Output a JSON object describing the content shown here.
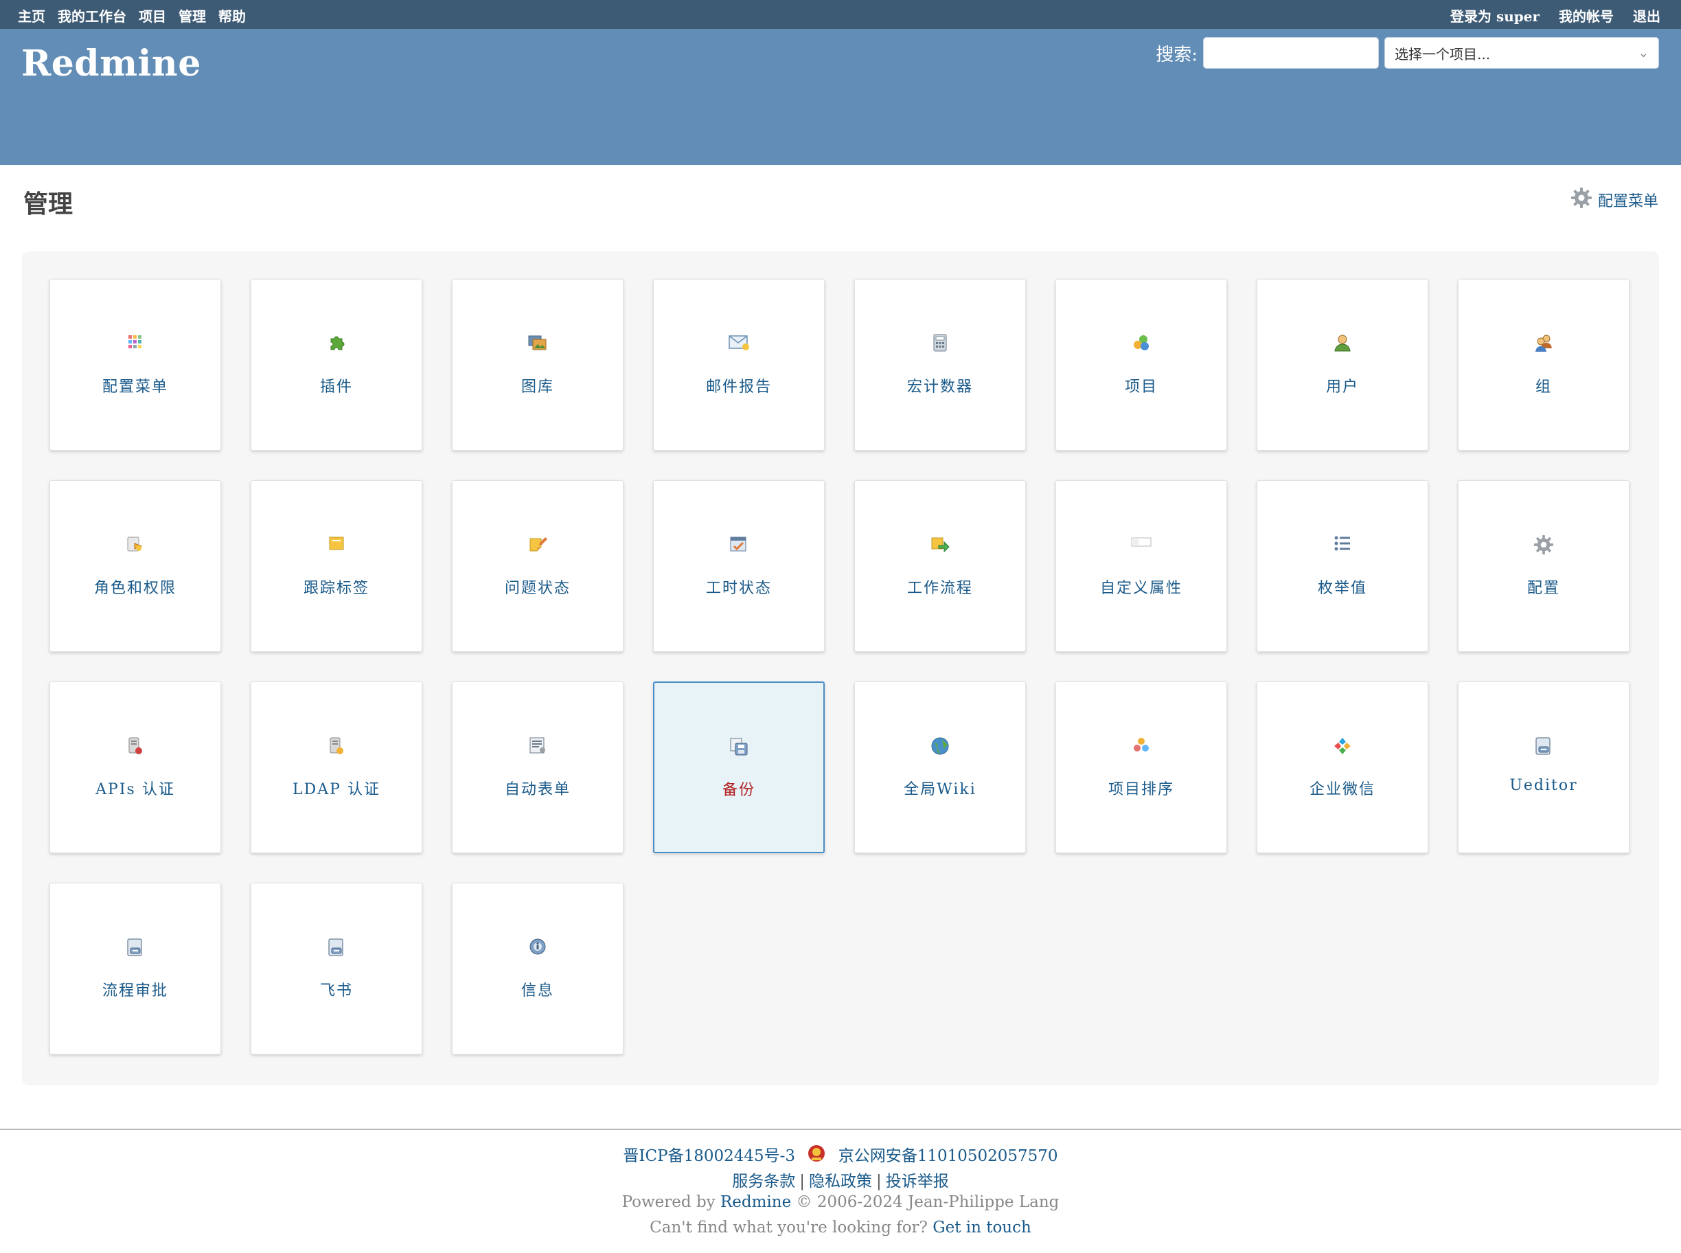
{
  "top_menu": {
    "home": "主页",
    "my_page": "我的工作台",
    "projects": "项目",
    "admin": "管理",
    "help": "帮助",
    "logged_as_prefix": "登录为",
    "logged_as_user": "super",
    "my_account": "我的帐号",
    "logout": "退出"
  },
  "header": {
    "title": "Redmine",
    "search_label": "搜索:",
    "search_value": "",
    "project_jump": "选择一个项目..."
  },
  "page": {
    "title": "管理",
    "config_menu_link": "配置菜单"
  },
  "admin_items": [
    {
      "label": "配置菜单",
      "icon": "grid-icon"
    },
    {
      "label": "插件",
      "icon": "plugin-icon"
    },
    {
      "label": "图库",
      "icon": "gallery-icon"
    },
    {
      "label": "邮件报告",
      "icon": "email-icon"
    },
    {
      "label": "宏计数器",
      "icon": "calculator-icon"
    },
    {
      "label": "项目",
      "icon": "projects-icon"
    },
    {
      "label": "用户",
      "icon": "user-icon"
    },
    {
      "label": "组",
      "icon": "group-icon"
    },
    {
      "label": "角色和权限",
      "icon": "role-icon"
    },
    {
      "label": "跟踪标签",
      "icon": "tracker-icon"
    },
    {
      "label": "问题状态",
      "icon": "issue-status-icon"
    },
    {
      "label": "工时状态",
      "icon": "time-status-icon"
    },
    {
      "label": "工作流程",
      "icon": "workflow-icon"
    },
    {
      "label": "自定义属性",
      "icon": "custom-field-icon"
    },
    {
      "label": "枚举值",
      "icon": "list-icon"
    },
    {
      "label": "配置",
      "icon": "settings-gear-icon"
    },
    {
      "label": "APIs 认证",
      "icon": "api-auth-icon"
    },
    {
      "label": "LDAP 认证",
      "icon": "ldap-icon"
    },
    {
      "label": "自动表单",
      "icon": "auto-form-icon"
    },
    {
      "label": "备份",
      "icon": "backup-icon",
      "selected": true
    },
    {
      "label": "全局Wiki",
      "icon": "globe-icon"
    },
    {
      "label": "项目排序",
      "icon": "sort-icon"
    },
    {
      "label": "企业微信",
      "icon": "wecom-icon"
    },
    {
      "label": "Ueditor",
      "icon": "editor-icon"
    },
    {
      "label": "流程审批",
      "icon": "approval-icon"
    },
    {
      "label": "飞书",
      "icon": "feishu-icon"
    },
    {
      "label": "信息",
      "icon": "info-icon"
    }
  ],
  "footer": {
    "icp": "晋ICP备18002445号-3",
    "police": "京公网安备11010502057570",
    "terms": "服务条款",
    "privacy": "隐私政策",
    "complaint": "投诉举报",
    "powered_by": "Powered by",
    "redmine_link": "Redmine",
    "copyright": "© 2006-2024 Jean-Philippe Lang",
    "cant_find": "Can't find what you're looking for?",
    "get_in_touch": "Get in touch"
  },
  "colors": {
    "top_menu_bg": "#3e5b76",
    "header_bg": "#628db6",
    "link": "#1a5a8a",
    "selected_label": "#b22222",
    "selected_bg": "#e8f3f8"
  }
}
